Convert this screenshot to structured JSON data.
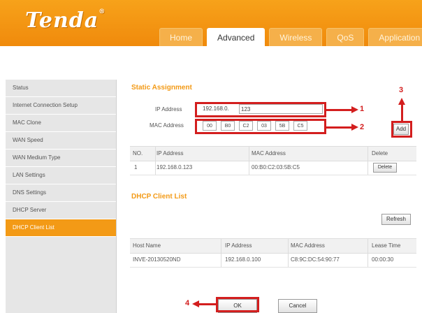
{
  "brand": {
    "logo": "Tenda"
  },
  "tabs": [
    "Home",
    "Advanced",
    "Wireless",
    "QoS",
    "Application"
  ],
  "sidebar": {
    "items": [
      "Status",
      "Internet Connection Setup",
      "MAC Clone",
      "WAN Speed",
      "WAN Medium Type",
      "LAN Settings",
      "DNS Settings",
      "DHCP Server",
      "DHCP Client List"
    ]
  },
  "static_assignment": {
    "title": "Static Assignment",
    "ip_label": "IP Address",
    "ip_prefix": "192.168.0.",
    "ip_last": "123",
    "mac_label": "MAC Address",
    "mac": [
      "00",
      "B0",
      "C2",
      "03",
      "5B",
      "C5"
    ],
    "add_label": "Add",
    "table": {
      "headers": [
        "NO.",
        "IP Address",
        "MAC Address",
        "Delete"
      ],
      "rows": [
        {
          "no": "1",
          "ip": "192.168.0.123",
          "mac": "00:B0:C2:03:5B:C5",
          "delete_label": "Delete"
        }
      ]
    }
  },
  "dhcp_client_list": {
    "title": "DHCP Client List",
    "refresh_label": "Refresh",
    "headers": [
      "Host Name",
      "IP Address",
      "MAC Address",
      "Lease Time"
    ],
    "rows": [
      {
        "host": "INVE-20130520ND",
        "ip": "192.168.0.100",
        "mac": "C8:9C:DC:54:90:77",
        "lease": "00:00:30"
      }
    ]
  },
  "footer": {
    "ok_label": "OK",
    "cancel_label": "Cancel"
  },
  "annotations": [
    "1",
    "2",
    "3",
    "4"
  ],
  "colors": {
    "accent": "#f39a16",
    "annotation": "#d31e1e"
  }
}
